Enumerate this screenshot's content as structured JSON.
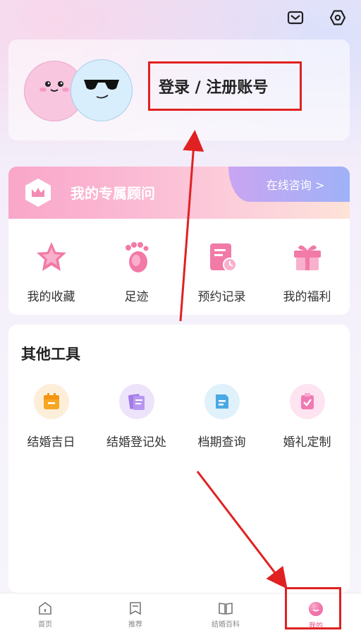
{
  "header": {
    "icons": [
      "mail-icon",
      "settings-icon"
    ]
  },
  "login": {
    "label": "登录 / 注册账号"
  },
  "advisor": {
    "title": "我的专属顾问",
    "consult_label": "在线咨询 >",
    "items": [
      {
        "label": "我的收藏",
        "icon": "star-icon"
      },
      {
        "label": "足迹",
        "icon": "footprint-icon"
      },
      {
        "label": "预约记录",
        "icon": "appointment-icon"
      },
      {
        "label": "我的福利",
        "icon": "gift-icon"
      }
    ]
  },
  "tools": {
    "title": "其他工具",
    "items": [
      {
        "label": "结婚吉日",
        "icon": "calendar-icon"
      },
      {
        "label": "结婚登记处",
        "icon": "certificate-icon"
      },
      {
        "label": "档期查询",
        "icon": "schedule-icon"
      },
      {
        "label": "婚礼定制",
        "icon": "clipboard-icon"
      }
    ]
  },
  "tabbar": {
    "tabs": [
      {
        "label": "首页",
        "icon": "home-icon"
      },
      {
        "label": "推荐",
        "icon": "bookmark-icon"
      },
      {
        "label": "结婚百科",
        "icon": "book-icon"
      },
      {
        "label": "我的",
        "icon": "profile-icon",
        "active": true
      }
    ]
  },
  "colors": {
    "accent_pink": "#f9a6c9",
    "annotation_red": "#e02121",
    "active_tab": "#e6508a"
  }
}
